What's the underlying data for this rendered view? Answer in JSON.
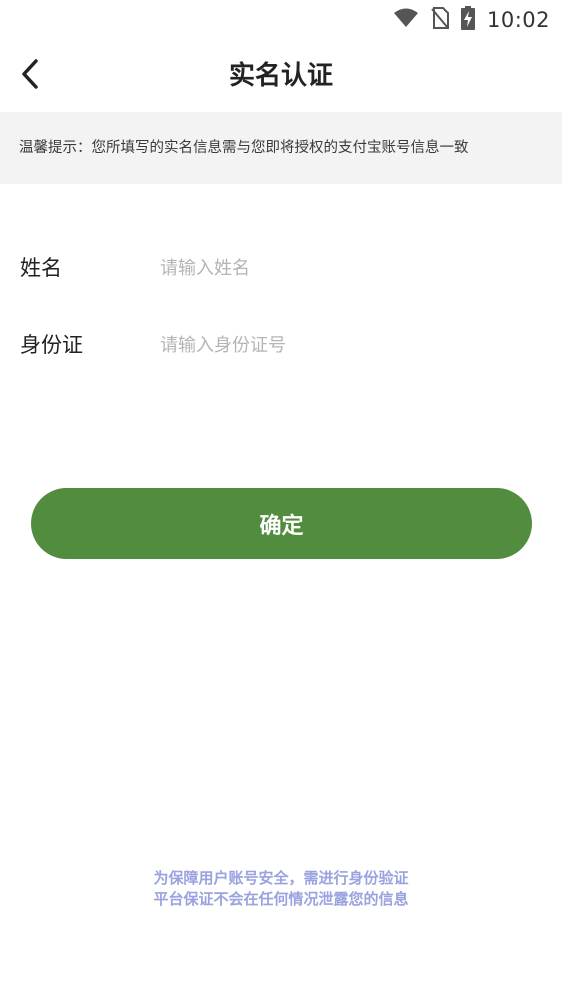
{
  "status_bar": {
    "time": "10:02",
    "icons": [
      "wifi-icon",
      "no-sim-icon",
      "battery-charging-icon"
    ]
  },
  "header": {
    "back_icon": "chevron-left-icon",
    "title": "实名认证"
  },
  "tip": {
    "text": "温馨提示：您所填写的实名信息需与您即将授权的支付宝账号信息一致"
  },
  "form": {
    "name": {
      "label": "姓名",
      "placeholder": "请输入姓名",
      "value": ""
    },
    "id_card": {
      "label": "身份证",
      "placeholder": "请输入身份证号",
      "value": ""
    }
  },
  "confirm_button": {
    "label": "确定",
    "color": "#528c3e"
  },
  "footer": {
    "lines": [
      "为保障用户账号安全，需进行身份验证",
      "平台保证不会在任何情况泄露您的信息"
    ],
    "color": "#9aa3df"
  }
}
